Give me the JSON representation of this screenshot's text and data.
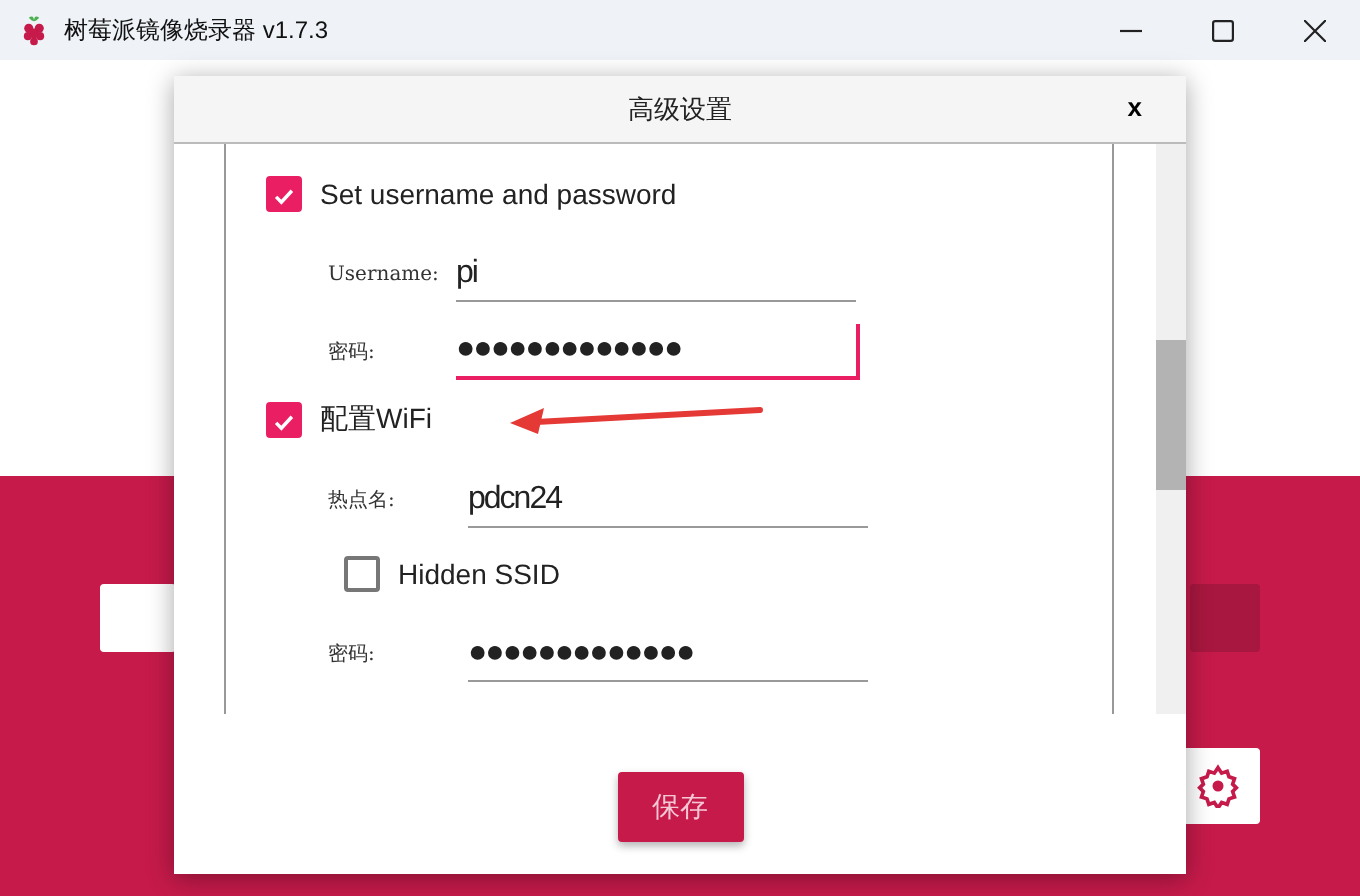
{
  "window": {
    "title": "树莓派镜像烧录器 v1.7.3"
  },
  "dialog": {
    "title": "高级设置",
    "close": "x",
    "items": [
      {
        "kind": "checkbox",
        "label": "Set username and password",
        "checked": true,
        "indent": false
      },
      {
        "kind": "text",
        "label": "Username:",
        "value": "pi",
        "focused": false,
        "indent": false
      },
      {
        "kind": "text",
        "label": "密码:",
        "value": "●●●●●●●●●●●●●",
        "focused": true,
        "indent": false
      },
      {
        "kind": "checkbox",
        "label": "配置WiFi",
        "checked": true,
        "indent": false,
        "arrow": true
      },
      {
        "kind": "text",
        "label": "热点名:",
        "value": "pdcn24",
        "focused": false,
        "indent": true
      },
      {
        "kind": "checkbox",
        "label": "Hidden SSID",
        "checked": false,
        "indent": true
      },
      {
        "kind": "text",
        "label": "密码:",
        "value": "●●●●●●●●●●●●●",
        "focused": false,
        "indent": true
      }
    ],
    "save": "保存"
  }
}
